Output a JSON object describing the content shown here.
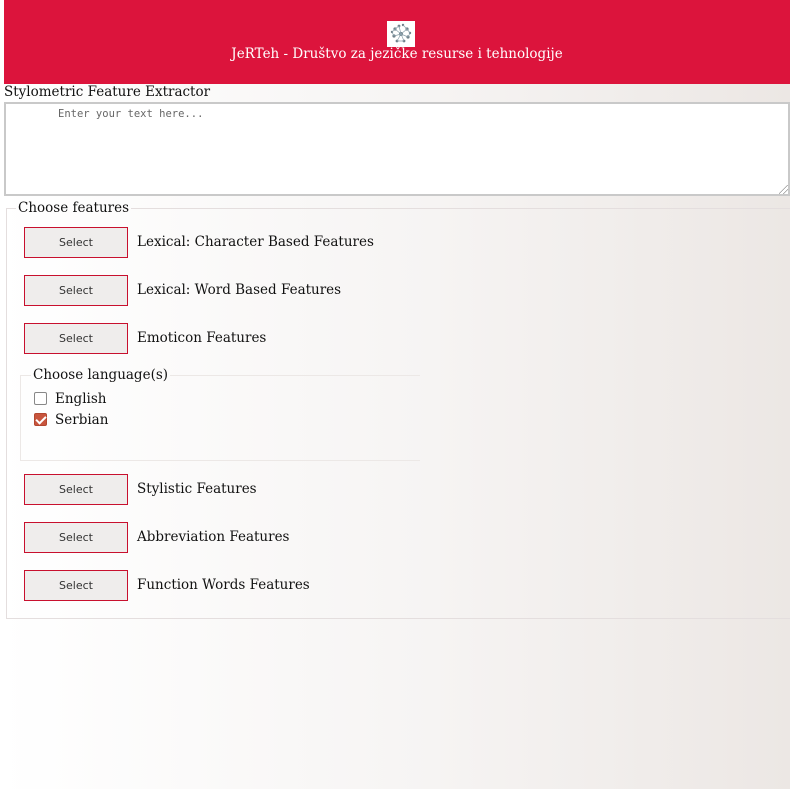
{
  "header": {
    "logo": "network-graph-logo",
    "title": "JeRTeh - Društvo za jezičke resurse i tehnologije",
    "color": "#dc143c"
  },
  "app": {
    "title": "Stylometric Feature Extractor"
  },
  "text_input": {
    "value": "",
    "placeholder": "Enter your text here..."
  },
  "features": {
    "legend": "Choose features",
    "groups": [
      {
        "button": "Select",
        "label": "Lexical: Character Based Features"
      },
      {
        "button": "Select",
        "label": "Lexical: Word Based Features"
      },
      {
        "button": "Select",
        "label": "Emoticon Features"
      },
      {
        "button": "Select",
        "label": "Stylistic Features"
      },
      {
        "button": "Select",
        "label": "Abbreviation Features"
      },
      {
        "button": "Select",
        "label": "Function Words Features"
      }
    ]
  },
  "languages": {
    "legend": "Choose language(s)",
    "options": [
      {
        "label": "English",
        "checked": false
      },
      {
        "label": "Serbian",
        "checked": true
      }
    ]
  },
  "colors": {
    "accent": "#c8102e",
    "checkbox_checked": "#c8553d"
  }
}
